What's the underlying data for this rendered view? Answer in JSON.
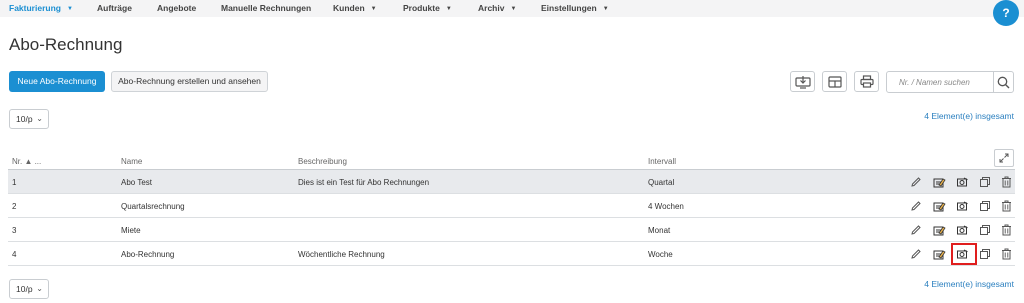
{
  "nav": {
    "items": [
      {
        "label": "Fakturierung",
        "caret": "▼",
        "active": true
      },
      {
        "label": "Aufträge",
        "caret": ""
      },
      {
        "label": "Angebote",
        "caret": ""
      },
      {
        "label": "Manuelle Rechnungen",
        "caret": ""
      },
      {
        "label": "Kunden",
        "caret": "▼"
      },
      {
        "label": "Produkte",
        "caret": "▼"
      },
      {
        "label": "Archiv",
        "caret": "▼"
      },
      {
        "label": "Einstellungen",
        "caret": "▼"
      }
    ],
    "help_label": "?"
  },
  "page": {
    "title": "Abo-Rechnung"
  },
  "toolbar": {
    "new_label": "Neue Abo-Rechnung",
    "create_view_label": "Abo-Rechnung erstellen und ansehen",
    "icons": [
      "monitor-download-icon",
      "table-layout-icon",
      "print-icon"
    ]
  },
  "search": {
    "placeholder": "Nr. / Namen suchen",
    "icon": "search-icon"
  },
  "pagination": {
    "page_size": "10/p",
    "total_text": "4 Element(e) insgesamt"
  },
  "table": {
    "columns": {
      "nr": "Nr. ▲ ...",
      "name": "Name",
      "description": "Beschreibung",
      "interval": "Intervall"
    },
    "rows": [
      {
        "nr": "1",
        "name": "Abo Test",
        "description": "Dies ist ein Test für Abo Rechnungen",
        "interval": "Quartal",
        "selected": true
      },
      {
        "nr": "2",
        "name": "Quartalsrechnung",
        "description": "",
        "interval": "4 Wochen"
      },
      {
        "nr": "3",
        "name": "Miete",
        "description": "",
        "interval": "Monat"
      },
      {
        "nr": "4",
        "name": "Abo-Rechnung",
        "description": "Wöchentliche Rechnung",
        "interval": "Woche"
      }
    ],
    "row_actions": [
      "edit-pencil-icon",
      "create-invoice-icon",
      "preview-icon",
      "copy-icon",
      "delete-trash-icon"
    ]
  },
  "colors": {
    "accent": "#1b8fd2",
    "highlight": "#e01e1e",
    "selected_row": "#e8eaed"
  }
}
